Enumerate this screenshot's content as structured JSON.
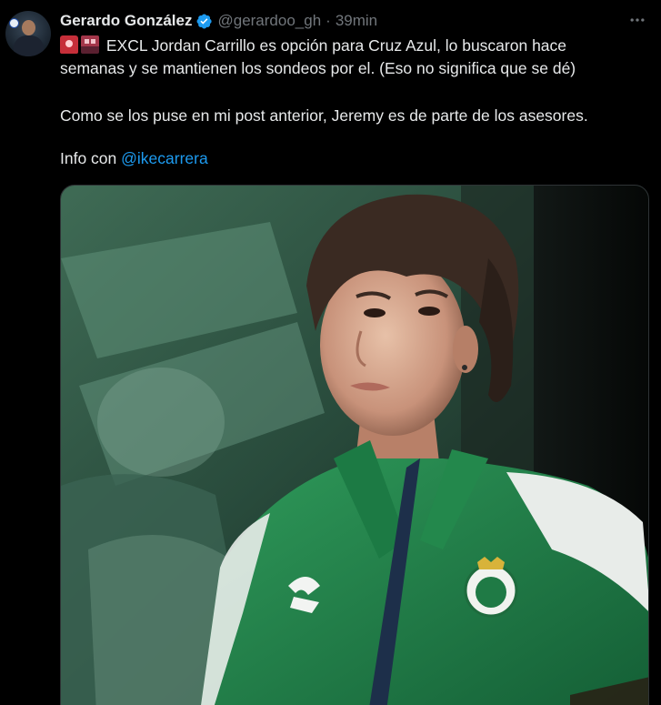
{
  "author": {
    "name": "Gerardo González",
    "handle": "@gerardoo_gh",
    "separator": "·",
    "time": "39min",
    "verified": true
  },
  "icons": {
    "avatar": "profile-photo",
    "verified": "verified-badge-icon",
    "more": "more-options-icon",
    "emoji_1": "police-light-emoji",
    "emoji_2": "train-emoji"
  },
  "tweet": {
    "line1": "EXCL Jordan Carrillo es opción para Cruz Azul, lo buscaron hace",
    "line2": "semanas y se mantienen los sondeos por el. (Eso no significa que se dé)",
    "paragraph2": "Como se los puse en mi post anterior, Jeremy es de parte de los asesores.",
    "paragraph3_prefix": "Info con ",
    "mention": "@ikecarrera"
  },
  "colors": {
    "background": "#000000",
    "text": "#e7e9ea",
    "secondary": "#71767b",
    "link": "#1d9bf0",
    "verified": "#1d9bf0",
    "jersey_green": "#1f7a45"
  }
}
